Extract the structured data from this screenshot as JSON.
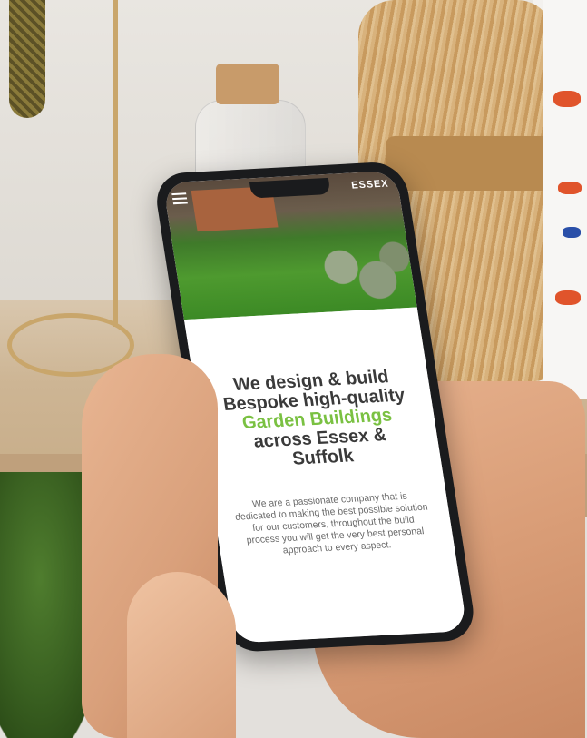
{
  "website": {
    "logo_text": "ESSEX",
    "headline_part1": "We design & build Bespoke high-quality ",
    "headline_highlight": "Garden Buildings",
    "headline_part2": " across Essex & Suffolk",
    "description": "We are a passionate company that is dedicated to making the best possible solution for our customers, throughout the build process you will get the very best personal approach to every aspect."
  },
  "colors": {
    "accent_green": "#7ac142",
    "headline_gray": "#3a3a3a",
    "body_gray": "#6a6a6a"
  },
  "icons": {
    "menu": "hamburger-menu-icon"
  }
}
